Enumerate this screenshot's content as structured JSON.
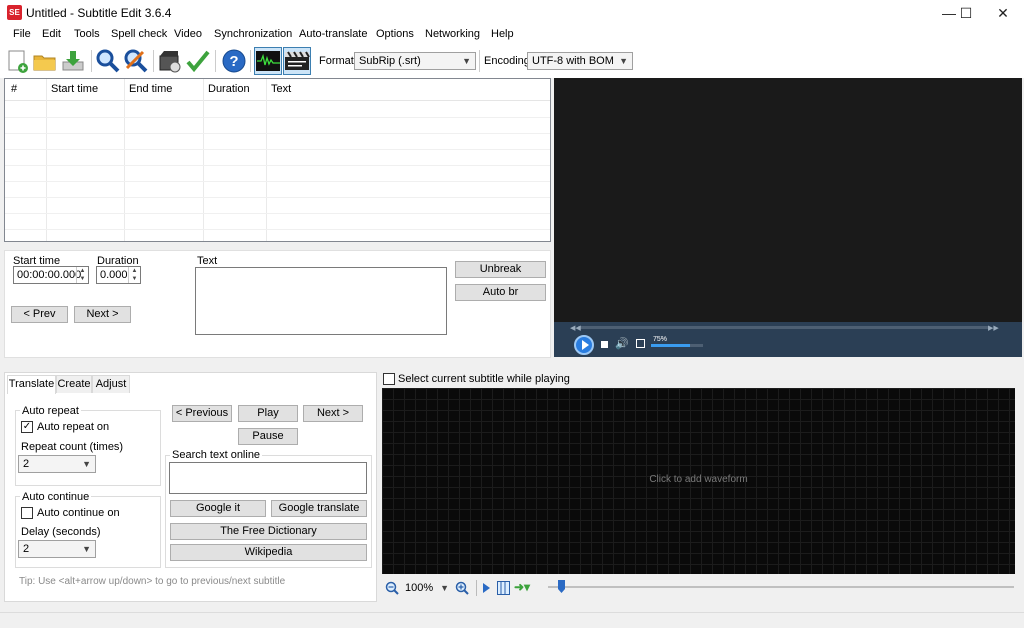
{
  "window": {
    "title": "Untitled - Subtitle Edit 3.6.4",
    "app_icon_text": "SE"
  },
  "menu": [
    "File",
    "Edit",
    "Tools",
    "Spell check",
    "Video",
    "Synchronization",
    "Auto-translate",
    "Options",
    "Networking",
    "Help"
  ],
  "toolbar": {
    "icons": [
      "new-file-icon",
      "open-folder-icon",
      "download-icon",
      "find-icon",
      "replace-icon",
      "video-icon",
      "checkmark-icon",
      "help-icon",
      "waveform-toggle-icon",
      "video-toggle-icon"
    ],
    "format_label": "Format",
    "format_value": "SubRip (.srt)",
    "encoding_label": "Encoding",
    "encoding_value": "UTF-8 with BOM"
  },
  "grid": {
    "columns": [
      "#",
      "Start time",
      "End time",
      "Duration",
      "Text"
    ]
  },
  "edit": {
    "start_label": "Start time",
    "start_value": "00:00:00.000",
    "duration_label": "Duration",
    "duration_value": "0.000",
    "text_label": "Text",
    "prev_btn": "< Prev",
    "next_btn": "Next >",
    "unbreak_btn": "Unbreak",
    "autobr_btn": "Auto br"
  },
  "player": {
    "volume_label": "75%",
    "volume": 0.75
  },
  "tabs": [
    "Translate",
    "Create",
    "Adjust"
  ],
  "translate": {
    "auto_repeat_group": "Auto repeat",
    "auto_repeat_on": "Auto repeat on",
    "auto_repeat_checked": true,
    "repeat_count_label": "Repeat count (times)",
    "repeat_count_value": "2",
    "auto_continue_group": "Auto continue",
    "auto_continue_on": "Auto continue on",
    "auto_continue_checked": false,
    "delay_label": "Delay (seconds)",
    "delay_value": "2",
    "previous_btn": "< Previous",
    "play_btn": "Play",
    "next_btn": "Next >",
    "pause_btn": "Pause",
    "search_online_label": "Search text online",
    "google_btn": "Google it",
    "google_translate_btn": "Google translate",
    "dictionary_btn": "The Free Dictionary",
    "wikipedia_btn": "Wikipedia",
    "tip": "Tip: Use <alt+arrow up/down> to go to previous/next subtitle"
  },
  "waveform": {
    "select_while_playing": "Select current subtitle while playing",
    "placeholder": "Click to add waveform",
    "zoom": "100%"
  }
}
